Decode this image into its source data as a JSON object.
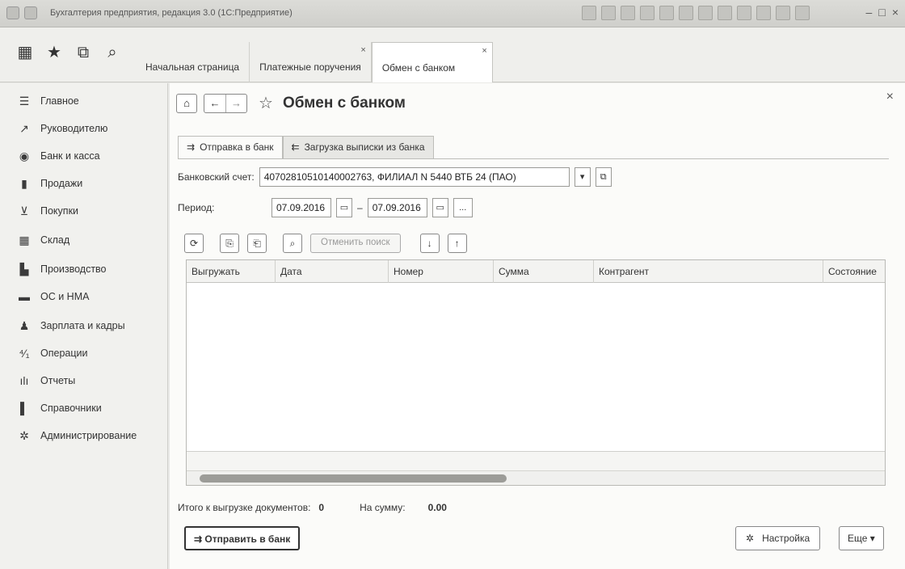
{
  "window": {
    "title": "Бухгалтерия предприятия, редакция 3.0 (1С:Предприятие)"
  },
  "top_icons": [
    {
      "icon": "apps-grid-icon",
      "glyph": "▦"
    },
    {
      "icon": "star-icon",
      "glyph": "★"
    },
    {
      "icon": "history-icon",
      "glyph": "⧉"
    },
    {
      "icon": "search-icon",
      "glyph": "⌕"
    }
  ],
  "tabs": [
    {
      "label": "Начальная страница",
      "closable": false,
      "active": false
    },
    {
      "label": "Платежные поручения",
      "closable": true,
      "active": false
    },
    {
      "label": "Обмен с банком",
      "closable": true,
      "active": true
    }
  ],
  "sidebar": {
    "items": [
      {
        "label": "Главное",
        "icon": "menu-icon",
        "glyph": "☰"
      },
      {
        "label": "Руководителю",
        "icon": "chart-icon",
        "glyph": "↗"
      },
      {
        "label": "Банк и касса",
        "icon": "bank-icon",
        "glyph": "◉"
      },
      {
        "label": "Продажи",
        "icon": "sales-icon",
        "glyph": "▮"
      },
      {
        "label": "Покупки",
        "icon": "cart-icon",
        "glyph": "⊻"
      },
      {
        "label": "Склад",
        "icon": "warehouse-icon",
        "glyph": "▦"
      },
      {
        "label": "Производство",
        "icon": "factory-icon",
        "glyph": "▙"
      },
      {
        "label": "ОС и НМА",
        "icon": "truck-icon",
        "glyph": "▬"
      },
      {
        "label": "Зарплата и кадры",
        "icon": "person-icon",
        "glyph": "♟"
      },
      {
        "label": "Операции",
        "icon": "operations-icon",
        "glyph": "⁴⁄₁"
      },
      {
        "label": "Отчеты",
        "icon": "reports-icon",
        "glyph": "ılı"
      },
      {
        "label": "Справочники",
        "icon": "book-icon",
        "glyph": "▌"
      },
      {
        "label": "Администрирование",
        "icon": "gear-icon",
        "glyph": "✲"
      }
    ]
  },
  "page": {
    "title": "Обмен с банком",
    "close_glyph": "×",
    "subtabs": [
      {
        "label": "Отправка в банк",
        "icon": "send-icon",
        "glyph": "⇉",
        "active": true
      },
      {
        "label": "Загрузка выписки из банка",
        "icon": "download-icon",
        "glyph": "⇇",
        "active": false
      }
    ],
    "account_label": "Банковский счет:",
    "account_value": "40702810510140002763, ФИЛИАЛ N 5440 ВТБ 24 (ПАО)",
    "period_label": "Период:",
    "period_from": "07.09.2016",
    "period_to": "07.09.2016",
    "period_dash": "–",
    "ellipsis": "...",
    "cancel_search": "Отменить поиск",
    "columns": [
      "Выгружать",
      "Дата",
      "Номер",
      "Сумма",
      "Контрагент",
      "Состояние"
    ],
    "totals_docs_label": "Итого к выгрузке документов:",
    "totals_docs_value": "0",
    "totals_sum_label": "На сумму:",
    "totals_sum_value": "0.00",
    "send_button": "Отправить в банк",
    "settings_button": "Настройка",
    "more_button": "Еще ▾"
  }
}
